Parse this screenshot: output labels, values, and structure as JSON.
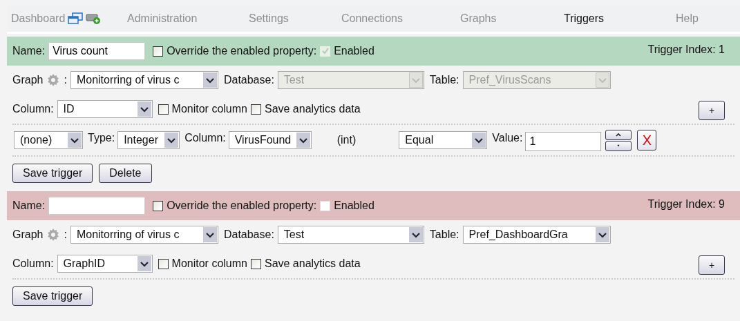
{
  "nav": [
    {
      "label": "Dashboard",
      "selected": false,
      "icons": true
    },
    {
      "label": "Administration",
      "selected": false
    },
    {
      "label": "Settings",
      "selected": false
    },
    {
      "label": "Connections",
      "selected": false
    },
    {
      "label": "Graphs",
      "selected": false
    },
    {
      "label": "Triggers",
      "selected": true
    },
    {
      "label": "Help",
      "selected": false
    }
  ],
  "triggers": [
    {
      "color": "#b5d9c0",
      "name_label": "Name:",
      "name": "Virus count",
      "override": {
        "label": "Override the enabled property:",
        "checked": false
      },
      "enabled": {
        "label": "Enabled",
        "checked": true,
        "disabled": true
      },
      "index": "Trigger Index: 1",
      "graph": {
        "label": "Graph",
        "colon": ":",
        "value": "Monitorring of virus c"
      },
      "database": {
        "label": "Database:",
        "value": "Test",
        "disabled": true
      },
      "table": {
        "label": "Table:",
        "value": "Pref_VirusScans",
        "disabled": true
      },
      "column": {
        "label": "Column:",
        "value": "ID"
      },
      "monitor": {
        "label": "Monitor column",
        "checked": false
      },
      "analytics": {
        "label": "Save analytics data",
        "checked": false
      },
      "add_button": "+",
      "conditions": [
        [
          {
            "kind": "select",
            "value": "(none)"
          },
          {
            "kind": "label",
            "text": "Type:"
          },
          {
            "kind": "select",
            "value": "Integer"
          },
          {
            "kind": "label",
            "text": "Column:"
          },
          {
            "kind": "select",
            "value": "VirusFound"
          },
          {
            "kind": "text",
            "text": "(int)"
          },
          {
            "kind": "select",
            "value": "Equal"
          },
          {
            "kind": "label",
            "text": "Value:"
          },
          {
            "kind": "input",
            "value": "1"
          },
          {
            "kind": "spinner"
          },
          {
            "kind": "delete",
            "text": "X"
          }
        ]
      ],
      "buttons": [
        "Save trigger",
        "Delete"
      ]
    },
    {
      "color": "#dfbdbe",
      "name_label": "Name:",
      "override": {
        "label": "Override the enabled property:",
        "checked": false
      },
      "enabled": {
        "label": "Enabled",
        "checked": false,
        "disabled": false
      },
      "index": "Trigger Index: 9",
      "graph": {
        "label": "Graph",
        "colon": ":",
        "value": "Monitorring of virus c"
      },
      "database": {
        "label": "Database:",
        "value": "Test",
        "disabled": false
      },
      "table": {
        "label": "Table:",
        "value": "Pref_DashboardGra",
        "disabled": false
      },
      "column": {
        "label": "Column:",
        "value": "GraphID"
      },
      "monitor": {
        "label": "Monitor column",
        "checked": false
      },
      "analytics": {
        "label": "Save analytics data",
        "checked": false
      },
      "add_button": "+",
      "buttons": [
        "Save trigger"
      ]
    }
  ]
}
